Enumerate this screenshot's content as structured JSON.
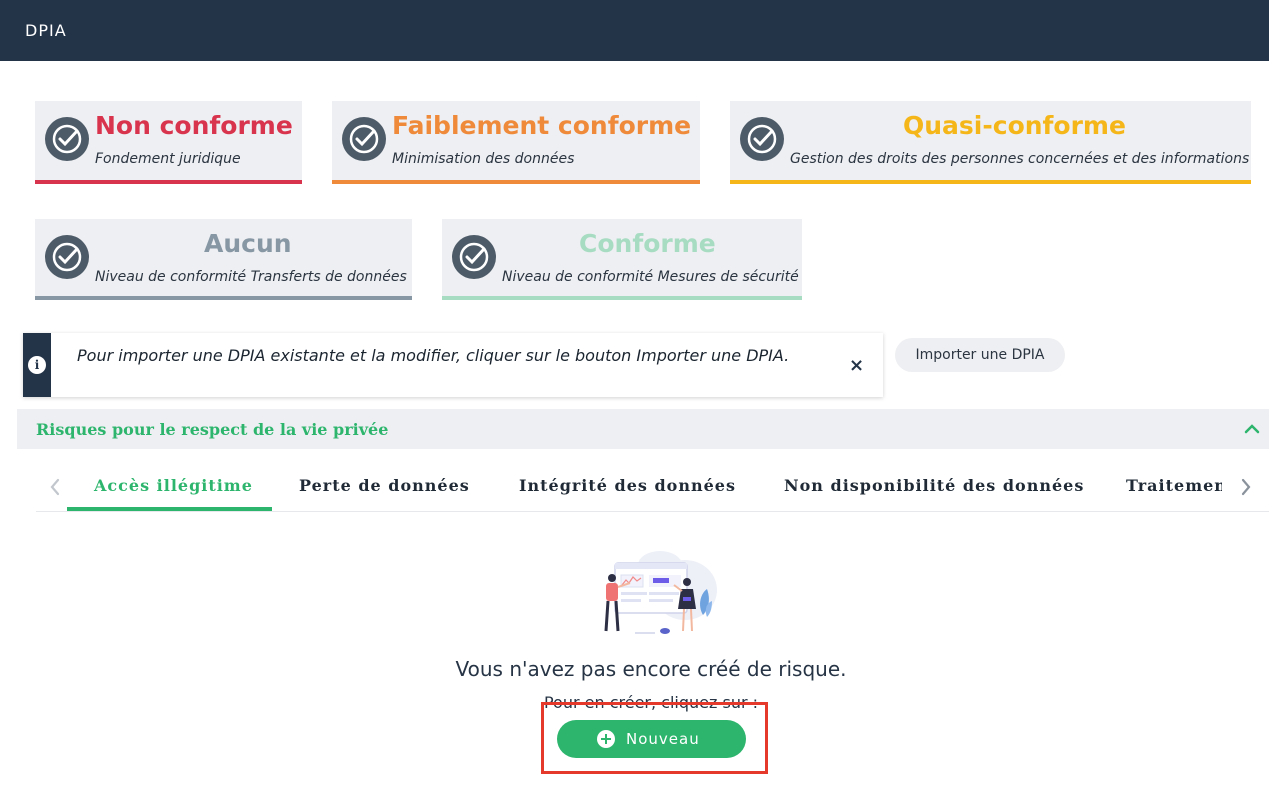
{
  "header": {
    "title": "DPIA"
  },
  "cards": [
    {
      "status": "Non conforme",
      "label": "Fondement juridique",
      "color": "#d9344e"
    },
    {
      "status": "Faiblement conforme",
      "label": "Minimisation des données",
      "color": "#ef8a3a"
    },
    {
      "status": "Quasi-conforme",
      "label": "Gestion des droits des personnes concernées et des informations",
      "color": "#f4b619"
    },
    {
      "status": "Aucun",
      "label": "Niveau de conformité Transferts de données",
      "color": "#8797a4"
    },
    {
      "status": "Conforme",
      "label": "Niveau de conformité Mesures de sécurité",
      "color": "#a7dcc2"
    }
  ],
  "info": {
    "message": "Pour importer une DPIA existante et la modifier, cliquer sur le bouton Importer une DPIA.",
    "close": "×"
  },
  "import_button": "Importer une DPIA",
  "section": {
    "title": "Risques pour le respect de la vie privée"
  },
  "tabs": [
    "Accès illégitime",
    "Perte de données",
    "Intégrité des données",
    "Non disponibilité des données",
    "Traitemen"
  ],
  "empty_state": {
    "title": "Vous n'avez pas encore créé de risque.",
    "subtitle": "Pour en créer, cliquez sur :",
    "button": "Nouveau"
  },
  "icons": {
    "card": "check-circle-icon",
    "info": "info-icon",
    "close": "close-icon",
    "accordion": "chevron-up-icon",
    "tab_prev": "chevron-left-icon",
    "tab_next": "chevron-right-icon",
    "new": "plus-circle-icon"
  }
}
